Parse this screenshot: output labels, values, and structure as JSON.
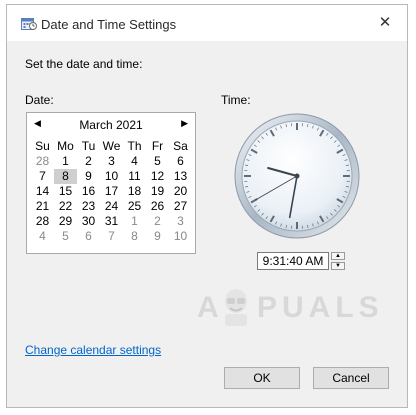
{
  "window": {
    "title": "Date and Time Settings",
    "close_glyph": "✕"
  },
  "prompt": "Set the date and time:",
  "date_label": "Date:",
  "time_label": "Time:",
  "calendar": {
    "month_label": "March 2021",
    "prev_glyph": "◀",
    "next_glyph": "▶",
    "weekdays": [
      "Su",
      "Mo",
      "Tu",
      "We",
      "Th",
      "Fr",
      "Sa"
    ],
    "weeks": [
      [
        {
          "d": "28",
          "other": true
        },
        {
          "d": "1"
        },
        {
          "d": "2"
        },
        {
          "d": "3"
        },
        {
          "d": "4"
        },
        {
          "d": "5"
        },
        {
          "d": "6"
        }
      ],
      [
        {
          "d": "7"
        },
        {
          "d": "8",
          "selected": true
        },
        {
          "d": "9"
        },
        {
          "d": "10"
        },
        {
          "d": "11"
        },
        {
          "d": "12"
        },
        {
          "d": "13"
        }
      ],
      [
        {
          "d": "14"
        },
        {
          "d": "15"
        },
        {
          "d": "16"
        },
        {
          "d": "17"
        },
        {
          "d": "18"
        },
        {
          "d": "19"
        },
        {
          "d": "20"
        }
      ],
      [
        {
          "d": "21"
        },
        {
          "d": "22"
        },
        {
          "d": "23"
        },
        {
          "d": "24"
        },
        {
          "d": "25"
        },
        {
          "d": "26"
        },
        {
          "d": "27"
        }
      ],
      [
        {
          "d": "28"
        },
        {
          "d": "29"
        },
        {
          "d": "30"
        },
        {
          "d": "31"
        },
        {
          "d": "1",
          "other": true
        },
        {
          "d": "2",
          "other": true
        },
        {
          "d": "3",
          "other": true
        }
      ],
      [
        {
          "d": "4",
          "other": true
        },
        {
          "d": "5",
          "other": true
        },
        {
          "d": "6",
          "other": true
        },
        {
          "d": "7",
          "other": true
        },
        {
          "d": "8",
          "other": true
        },
        {
          "d": "9",
          "other": true
        },
        {
          "d": "10",
          "other": true
        }
      ]
    ]
  },
  "clock": {
    "hours": 9,
    "minutes": 31,
    "seconds": 40
  },
  "time_value": "9:31:40 AM",
  "watermark": {
    "a": "A",
    "rest": "PUALS"
  },
  "change_calendar_link": "Change calendar settings",
  "buttons": {
    "ok": "OK",
    "cancel": "Cancel"
  },
  "colors": {
    "link": "#0066cc",
    "selected_day": "#cfcfcf",
    "dialog_bg": "#f0f0f0"
  }
}
